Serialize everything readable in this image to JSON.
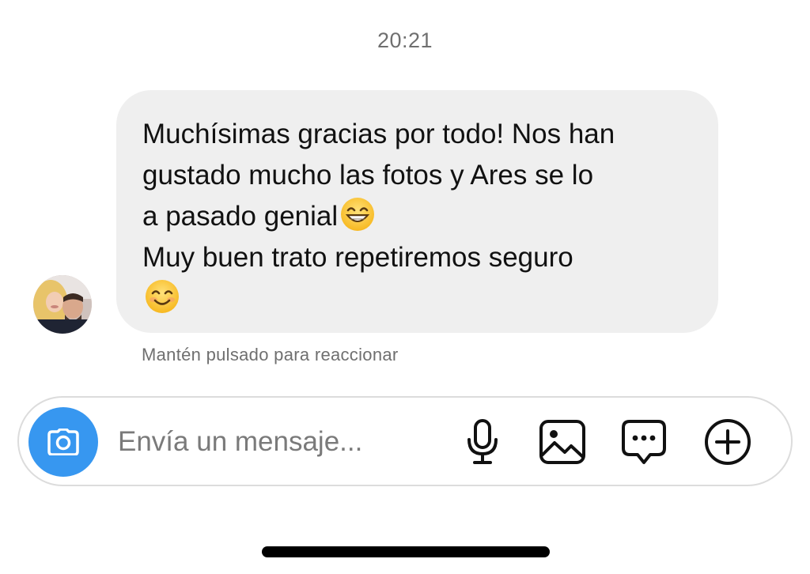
{
  "conversation": {
    "timestamp": "20:21",
    "message": {
      "lines": [
        "Muchísimas gracias por todo! Nos han",
        "gustado mucho las fotos y Ares se lo",
        "a pasado genial",
        "Muy buen trato repetiremos seguro"
      ],
      "emojis": [
        "grinning-face-with-smiling-eyes",
        "smiling-face-with-smiling-eyes"
      ]
    },
    "reaction_hint": "Mantén pulsado para reaccionar"
  },
  "composer": {
    "placeholder": "Envía un mensaje...",
    "value": "",
    "icons": [
      "camera-icon",
      "microphone-icon",
      "gallery-icon",
      "sticker-chat-icon",
      "add-circle-icon"
    ],
    "accent_color": "#3797f0"
  },
  "colors": {
    "bubble_background": "#efefef",
    "secondary_text": "#6f6f6f"
  }
}
